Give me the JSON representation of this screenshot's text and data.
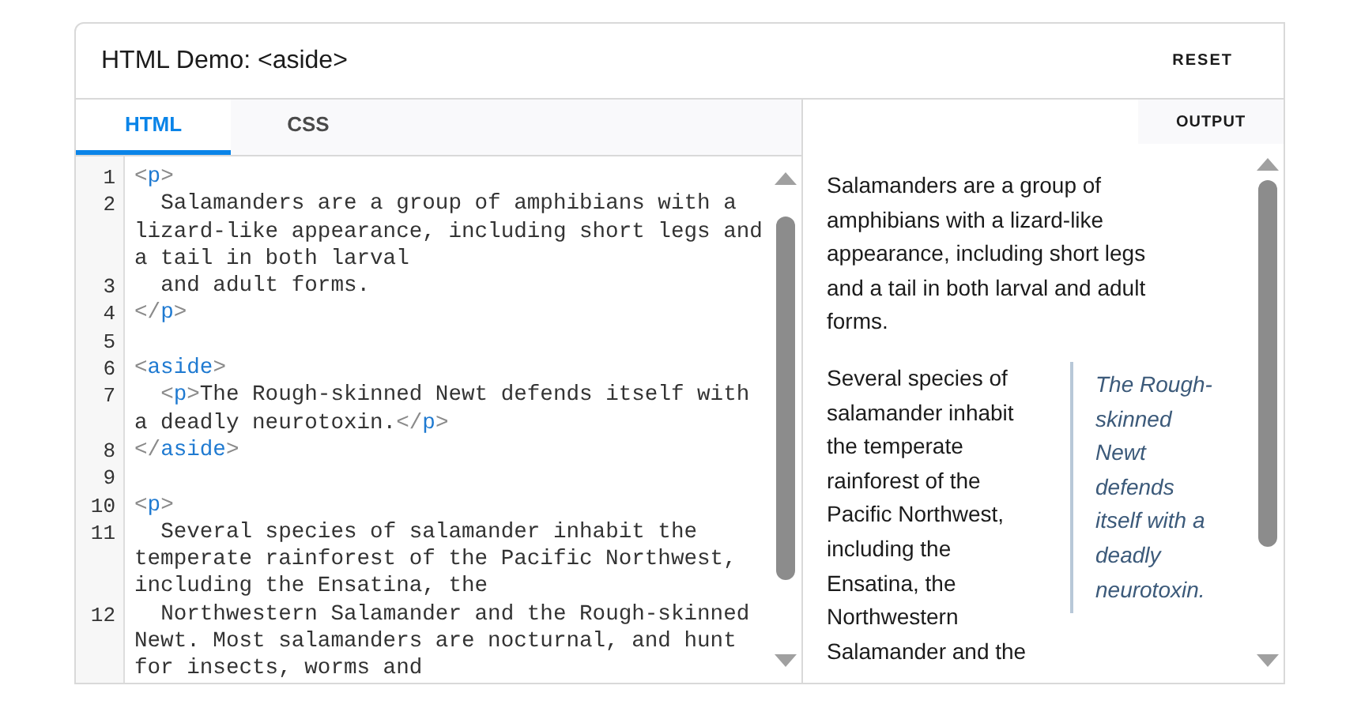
{
  "header": {
    "title": "HTML Demo: <aside>",
    "reset_button": "RESET"
  },
  "tabs": [
    {
      "label": "HTML",
      "selected": true
    },
    {
      "label": "CSS",
      "selected": false
    }
  ],
  "output_label": "OUTPUT",
  "code_lines": [
    {
      "number": "1",
      "segments": [
        {
          "kind": "punct",
          "text": "<"
        },
        {
          "kind": "tag",
          "text": "p"
        },
        {
          "kind": "punct",
          "text": ">"
        }
      ]
    },
    {
      "number": "2",
      "segments": [
        {
          "kind": "text",
          "text": "  Salamanders are a group of amphibians with a lizard-like appearance, including short legs and a tail in both larval"
        }
      ]
    },
    {
      "number": "3",
      "segments": [
        {
          "kind": "text",
          "text": "  and adult forms."
        }
      ]
    },
    {
      "number": "4",
      "segments": [
        {
          "kind": "punct",
          "text": "</"
        },
        {
          "kind": "tag",
          "text": "p"
        },
        {
          "kind": "punct",
          "text": ">"
        }
      ]
    },
    {
      "number": "5"
    },
    {
      "number": "6",
      "segments": [
        {
          "kind": "punct",
          "text": "<"
        },
        {
          "kind": "tag",
          "text": "aside"
        },
        {
          "kind": "punct",
          "text": ">"
        }
      ]
    },
    {
      "number": "7",
      "segments": [
        {
          "kind": "punct",
          "text": "  <"
        },
        {
          "kind": "tag",
          "text": "p"
        },
        {
          "kind": "punct",
          "text": ">"
        },
        {
          "kind": "text",
          "text": "The Rough-skinned Newt defends itself with a deadly neurotoxin."
        },
        {
          "kind": "punct",
          "text": "</"
        },
        {
          "kind": "tag",
          "text": "p"
        },
        {
          "kind": "punct",
          "text": ">"
        }
      ]
    },
    {
      "number": "8",
      "segments": [
        {
          "kind": "punct",
          "text": "</"
        },
        {
          "kind": "tag",
          "text": "aside"
        },
        {
          "kind": "punct",
          "text": ">"
        }
      ]
    },
    {
      "number": "9"
    },
    {
      "number": "10",
      "segments": [
        {
          "kind": "punct",
          "text": "<"
        },
        {
          "kind": "tag",
          "text": "p"
        },
        {
          "kind": "punct",
          "text": ">"
        }
      ]
    },
    {
      "number": "11",
      "segments": [
        {
          "kind": "text",
          "text": "  Several species of salamander inhabit the temperate rainforest of the Pacific Northwest, including the Ensatina, the"
        }
      ]
    },
    {
      "number": "12",
      "segments": [
        {
          "kind": "text",
          "text": "  Northwestern Salamander and the Rough-skinned Newt. Most salamanders are nocturnal, and hunt for insects, worms and"
        }
      ]
    }
  ],
  "output": {
    "paragraph_1": "Salamanders are a group of amphibians with a lizard-like appearance, including short legs and a tail in both larval and adult forms.",
    "paragraph_2": "Several species of salamander inhabit the temperate rainforest of the Pacific Northwest, including the Ensatina, the Northwestern Salamander and the",
    "aside": "The Rough-skinned Newt defends itself with a deadly neurotoxin."
  }
}
